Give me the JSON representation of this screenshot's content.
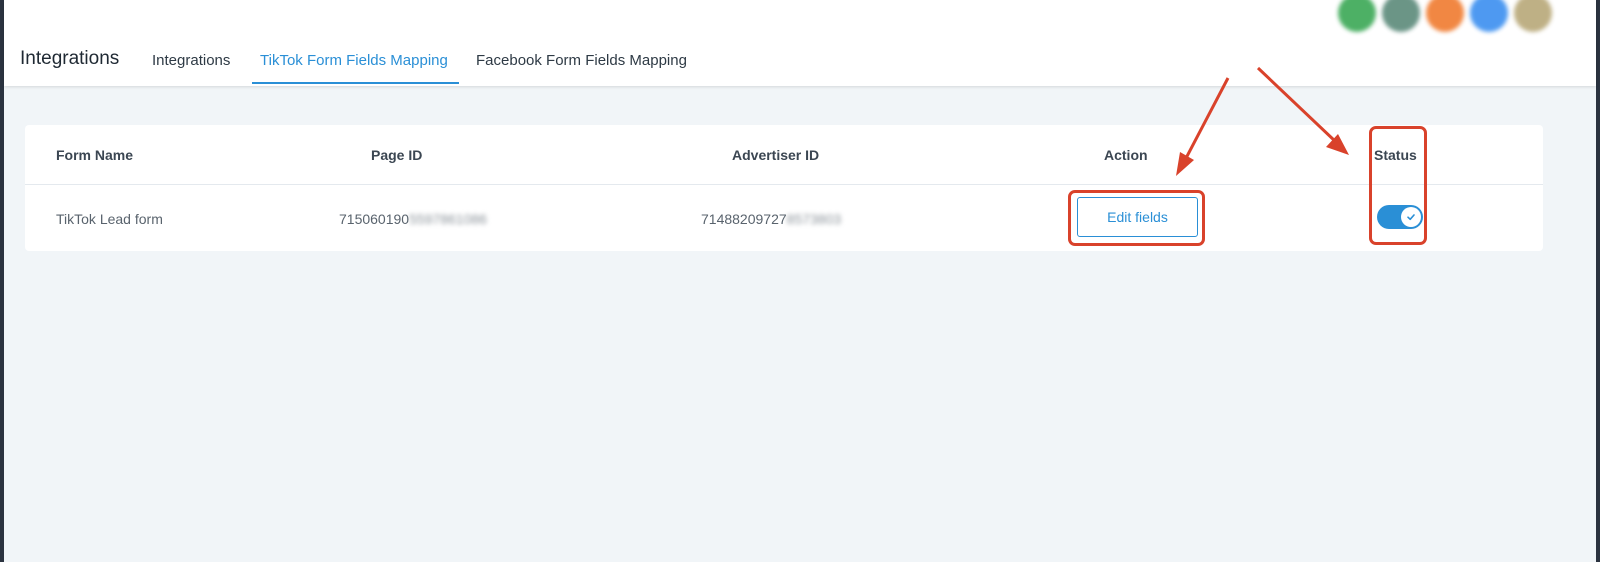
{
  "header": {
    "page_title": "Integrations",
    "tabs": [
      {
        "label": "Integrations",
        "active": false
      },
      {
        "label": "TikTok Form Fields Mapping",
        "active": true
      },
      {
        "label": "Facebook Form Fields Mapping",
        "active": false
      }
    ],
    "avatar_colors": [
      "#3aa855",
      "#5b8a7a",
      "#f07b2f",
      "#3b8ff0",
      "#b8a878"
    ]
  },
  "table": {
    "columns": [
      "Form Name",
      "Page ID",
      "Advertiser ID",
      "Action",
      "Status"
    ],
    "rows": [
      {
        "form_name": "TikTok Lead form",
        "page_id_visible": "715060190",
        "page_id_blurred": "5597861086",
        "advertiser_id_visible": "71488209727",
        "advertiser_id_blurred": "8573803",
        "action_label": "Edit fields",
        "status_on": true
      }
    ]
  },
  "colors": {
    "accent": "#2a8fd6",
    "annotation": "#d9422b",
    "background": "#f1f5f8"
  },
  "icons": {
    "status_toggle_check": "check-icon"
  }
}
